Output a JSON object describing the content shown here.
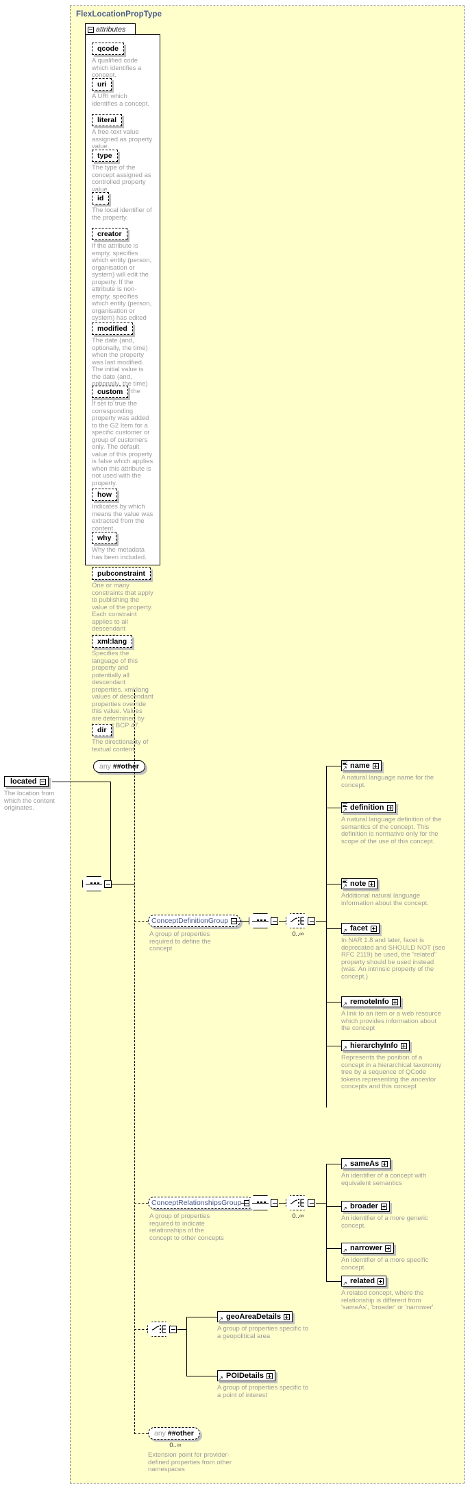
{
  "type": {
    "title": "FlexLocationPropType",
    "attributes_label": "attributes"
  },
  "attributes": [
    {
      "name": "qcode",
      "desc": "A qualified code which identifies a concept."
    },
    {
      "name": "uri",
      "desc": "A URI which identifies a concept."
    },
    {
      "name": "literal",
      "desc": "A free-text value assigned as property value."
    },
    {
      "name": "type",
      "desc": "The type of the concept assigned as controlled property value."
    },
    {
      "name": "id",
      "desc": "The local identifier of the property."
    },
    {
      "name": "creator",
      "desc": "If the attribute is empty, specifies which entity (person, organisation or system) will edit the property. If the attribute is non-empty, specifies which entity (person, organisation or system) has edited the property."
    },
    {
      "name": "modified",
      "desc": "The date (and, optionally, the time) when the property was last modified. The initial value is the date (and, optionally, the time) of creation of the property."
    },
    {
      "name": "custom",
      "desc": "If set to true the corresponding property was added to the G2 Item for a specific customer or group of customers only. The default value of this property is false which applies when this attribute is not used with the property."
    },
    {
      "name": "how",
      "desc": "Indicates by which means the value was extracted from the content."
    },
    {
      "name": "why",
      "desc": "Why the metadata has been included."
    },
    {
      "name": "pubconstraint",
      "desc": "One or many constraints that apply to publishing the value of the property. Each constraint applies to all descendant elements."
    },
    {
      "name": "xml:lang",
      "desc": "Specifies the language of this property and potentially all descendant properties. xml:lang values of descendant properties override this value. Values are determined by Internet BCP 47."
    },
    {
      "name": "dir",
      "desc": "The directionality of textual content."
    }
  ],
  "attributes_any": {
    "keyword": "any",
    "namespace": "##other"
  },
  "root_element": {
    "name": "located",
    "desc": "The location from which the content originates."
  },
  "groups": {
    "definition": {
      "name": "ConceptDefinitionGroup",
      "desc": "A group of properties required to define the concept",
      "occurs": "0..∞",
      "members": [
        {
          "name": "name",
          "desc": "A natural language name for the concept."
        },
        {
          "name": "definition",
          "desc": "A natural language definition of the semantics of the concept. This definition is normative only for the scope of the use of this concept."
        },
        {
          "name": "note",
          "desc": "Additional natural language information about the concept."
        },
        {
          "name": "facet",
          "desc": "In NAR 1.8 and later, facet is deprecated and SHOULD NOT (see RFC 2119) be used, the \"related\" property should be used instead (was: An intrinsic property of the concept.)"
        },
        {
          "name": "remoteInfo",
          "desc": "A link to an item or a web resource which provides information about the concept"
        },
        {
          "name": "hierarchyInfo",
          "desc": "Represents the position of a concept in a hierarchical taxonomy tree by a sequence of QCode tokens representing the ancestor concepts and this concept"
        }
      ]
    },
    "relationships": {
      "name": "ConceptRelationshipsGroup",
      "desc": "A group of properties required to indicate relationships of the concept to other concepts",
      "occurs": "0..∞",
      "members": [
        {
          "name": "sameAs",
          "desc": "An identifier of a concept with equivalent semantics"
        },
        {
          "name": "broader",
          "desc": "An identifier of a more generic concept."
        },
        {
          "name": "narrower",
          "desc": "An identifier of a more specific concept."
        },
        {
          "name": "related",
          "desc": "A related concept, where the relationship is different from 'sameAs', 'broader' or 'narrower'."
        }
      ]
    }
  },
  "details_choice": {
    "members": [
      {
        "name": "geoAreaDetails",
        "desc": "A group of properties specific to a geopolitical area"
      },
      {
        "name": "POIDetails",
        "desc": "A group of properties specific to a point of interest"
      }
    ]
  },
  "trailing_any": {
    "keyword": "any",
    "namespace": "##other",
    "occurs": "0..∞",
    "desc": "Extension point for provider-defined properties from other namespaces"
  },
  "colors": {
    "type_background": "#ffffcc",
    "type_title": "#4a5a8a",
    "description_text": "#9a9a9a",
    "group_name": "#4a5a8a",
    "shadow": "#c0c0c0"
  }
}
